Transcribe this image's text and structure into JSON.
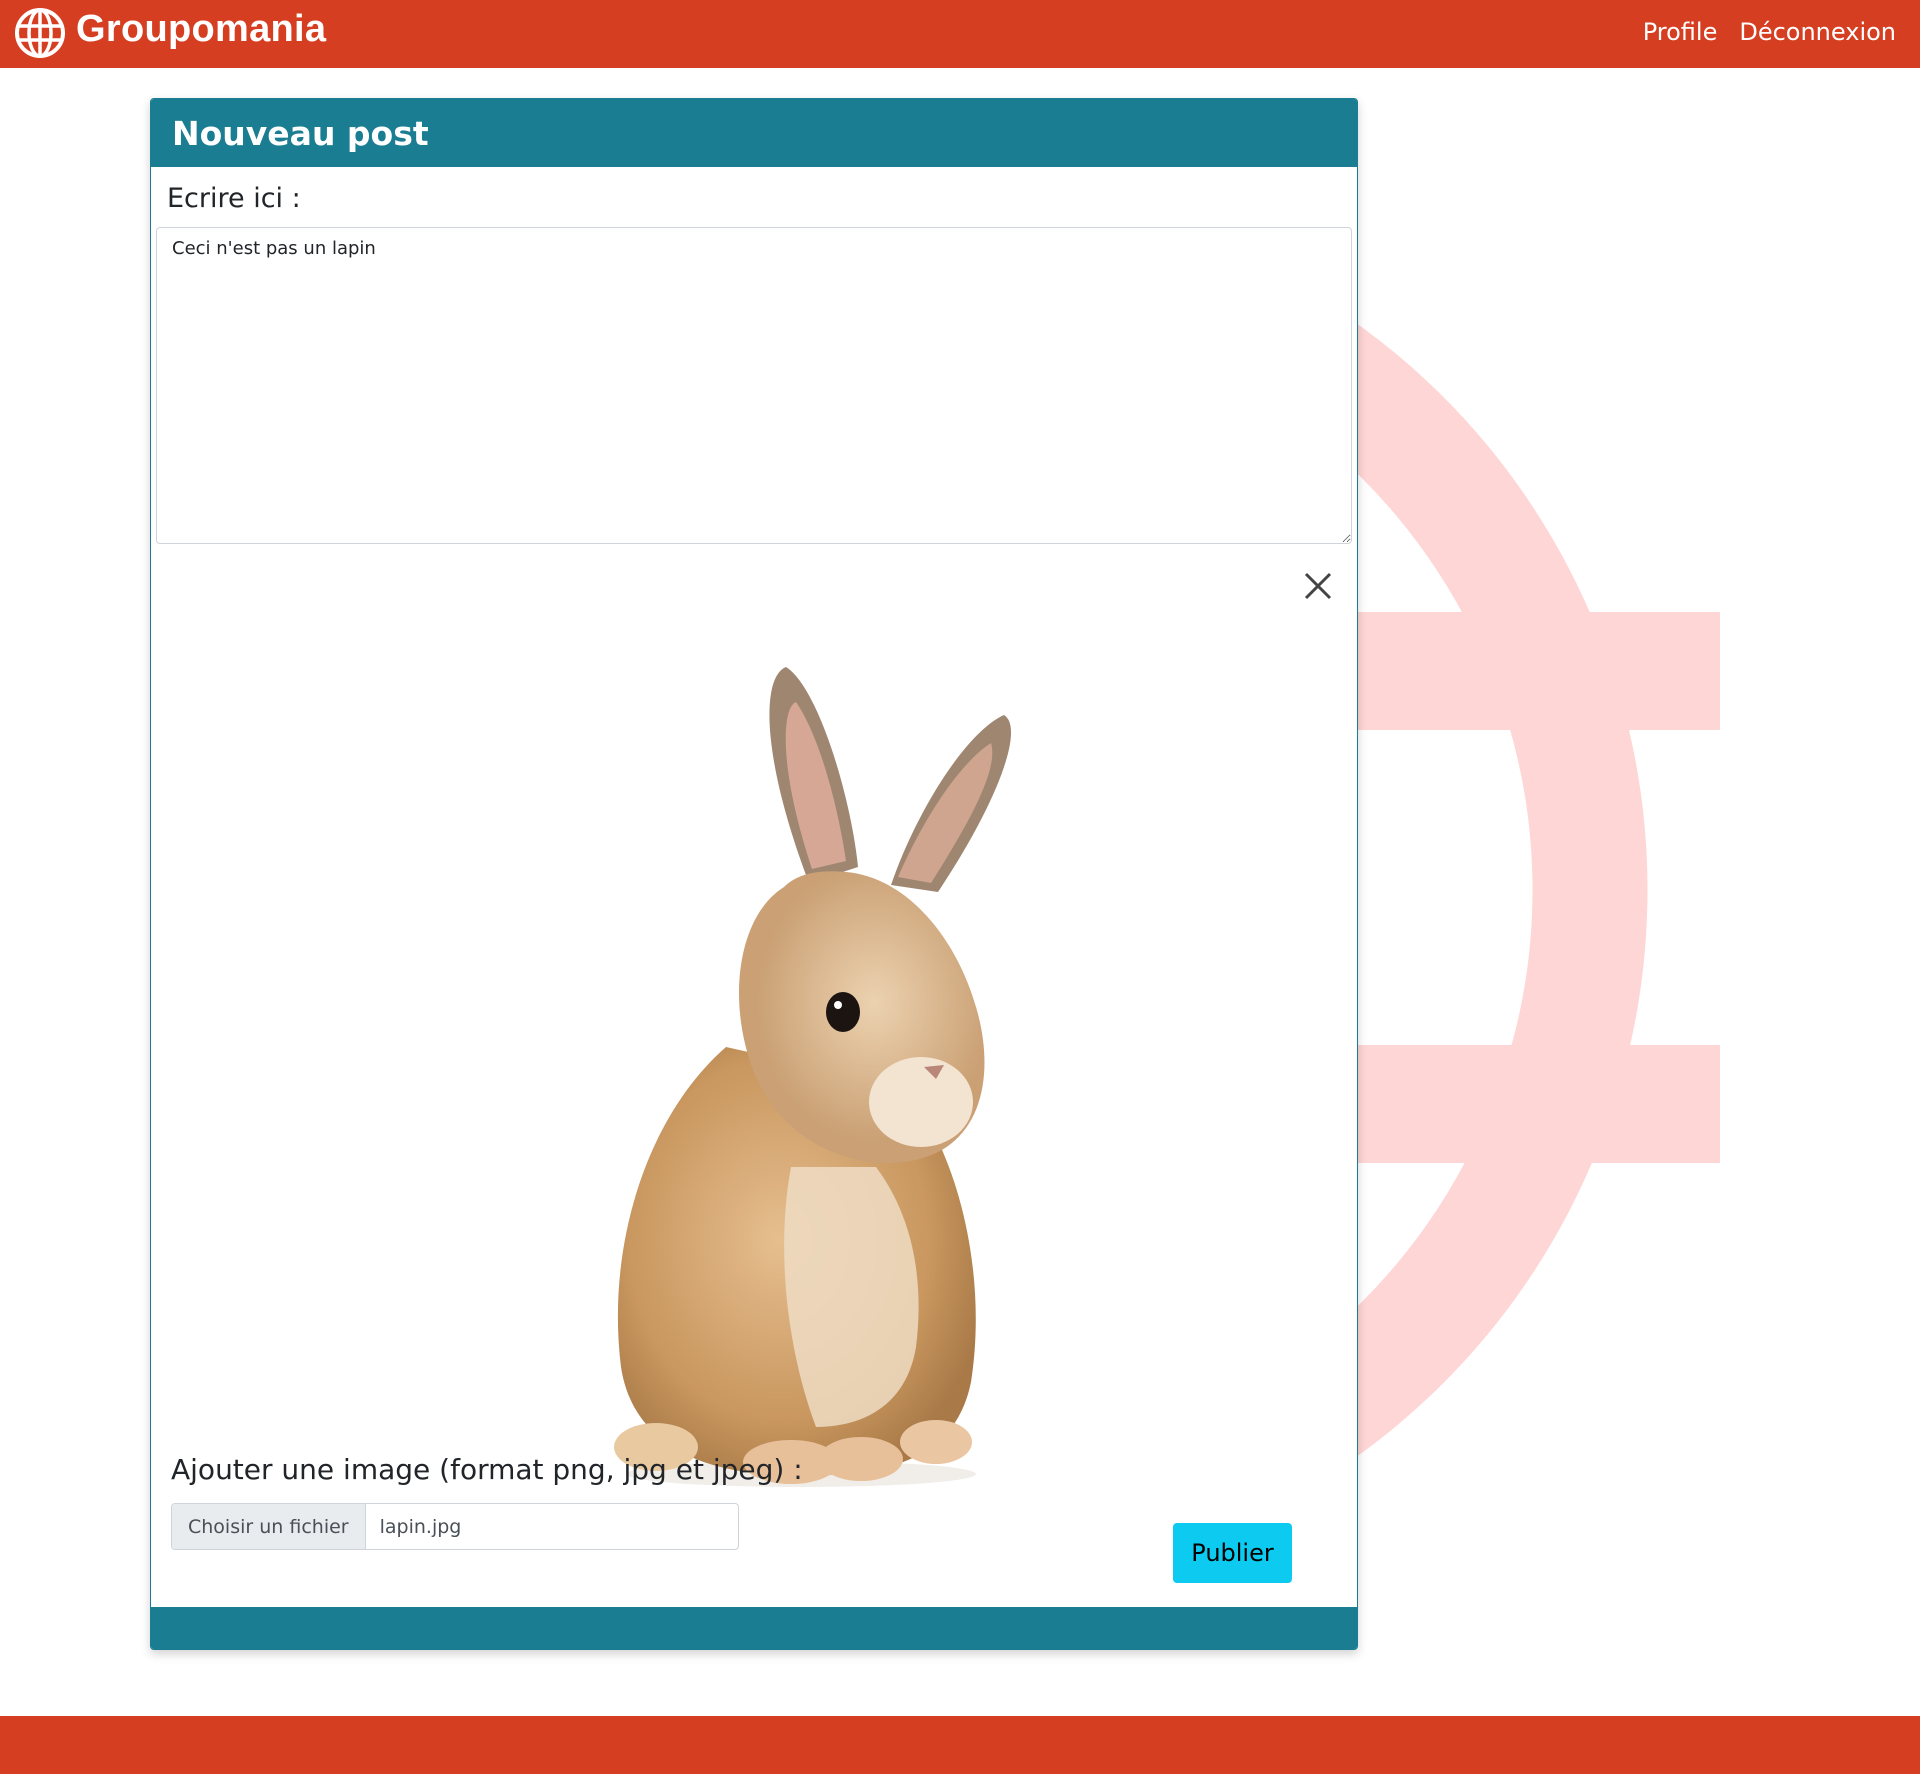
{
  "app": {
    "name": "Groupomania",
    "logo_icon": "globe-icon",
    "brand_color": "#d63e22",
    "card_color": "#1a7d92",
    "accent_color": "#0dcaf0"
  },
  "nav": {
    "profile_label": "Profile",
    "logout_label": "Déconnexion"
  },
  "post_form": {
    "title": "Nouveau post",
    "text_label": "Ecrire ici :",
    "text_value": "Ceci n'est pas un lapin",
    "close_icon": "close-icon",
    "preview_image": "rabbit-photo",
    "image_label": "Ajouter une image (format png, jpg et jpeg) :",
    "file_button_label": "Choisir un fichier",
    "file_name": "lapin.jpg",
    "publish_label": "Publier"
  }
}
